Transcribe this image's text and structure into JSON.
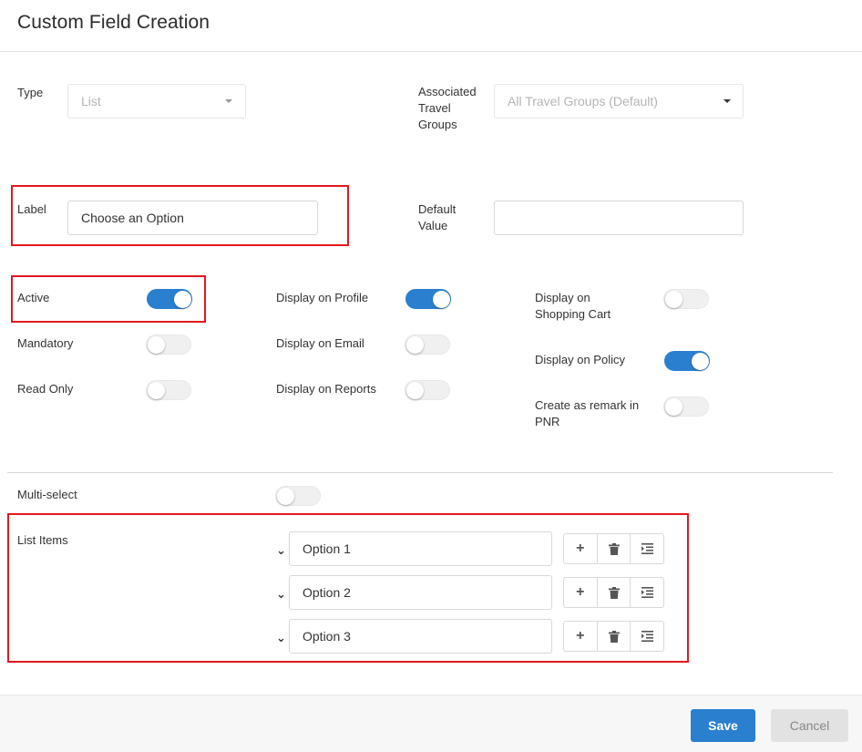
{
  "header": {
    "title": "Custom Field Creation"
  },
  "type": {
    "label": "Type",
    "value": "List"
  },
  "travel_groups": {
    "label_lines": [
      "Associated",
      "Travel",
      "Groups"
    ],
    "value": "All Travel Groups (Default)"
  },
  "label_field": {
    "label": "Label",
    "value": "Choose an Option"
  },
  "default_value": {
    "label_lines": [
      "Default",
      "Value"
    ],
    "value": ""
  },
  "toggles": {
    "active": {
      "label": "Active",
      "on": true
    },
    "mandatory": {
      "label": "Mandatory",
      "on": false
    },
    "read_only": {
      "label": "Read Only",
      "on": false
    },
    "display_profile": {
      "label": "Display on Profile",
      "on": true
    },
    "display_email": {
      "label": "Display on Email",
      "on": false
    },
    "display_reports": {
      "label": "Display on Reports",
      "on": false
    },
    "display_cart": {
      "label_lines": [
        "Display on",
        "Shopping Cart"
      ],
      "on": false
    },
    "display_policy": {
      "label": "Display on Policy",
      "on": true
    },
    "remark_pnr": {
      "label_lines": [
        "Create as remark in",
        "PNR"
      ],
      "on": false
    },
    "multi_select": {
      "label": "Multi-select",
      "on": false
    }
  },
  "list_items": {
    "label": "List Items",
    "items": [
      "Option 1",
      "Option 2",
      "Option 3"
    ],
    "icons": {
      "expand": "chevron-down-icon",
      "add": "plus-icon",
      "delete": "trash-icon",
      "indent": "indent-icon"
    }
  },
  "footer": {
    "save_label": "Save",
    "cancel_label": "Cancel"
  },
  "colors": {
    "accent": "#2a80cf",
    "highlight": "#e2181d"
  }
}
